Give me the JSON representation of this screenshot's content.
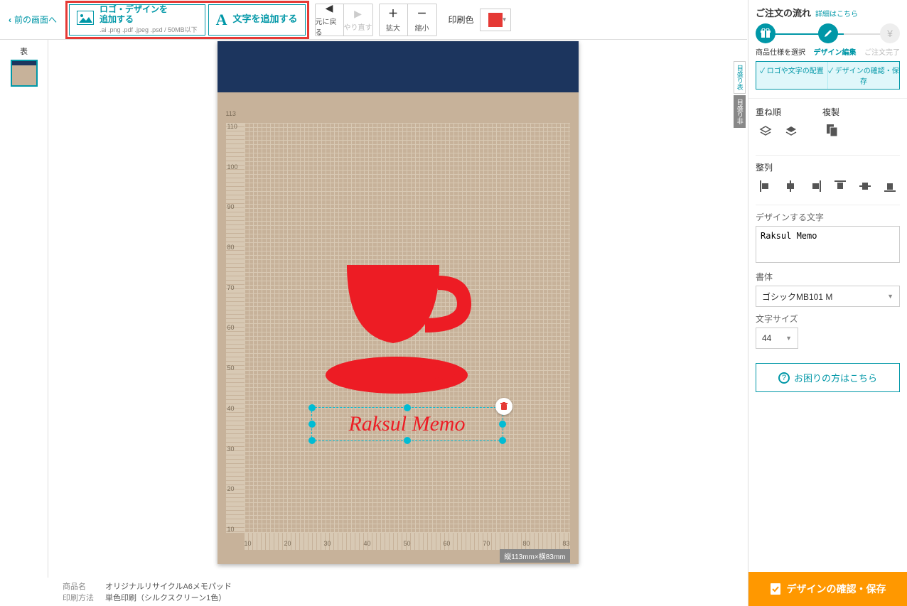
{
  "toolbar": {
    "back": "前の画面へ",
    "addLogo": {
      "main1": "ロゴ・デザインを",
      "main2": "追加する",
      "sub": ".ai .png .pdf .jpeg .psd / 50MB以下"
    },
    "addText": "文字を追加する",
    "undo": "元に戻る",
    "redo": "やり直す",
    "zoomIn": "拡大",
    "zoomOut": "縮小",
    "printColorLabel": "印刷色"
  },
  "leftRail": {
    "front": "表"
  },
  "sideTabs": {
    "show": "目盛り表",
    "hide": "目盛り非"
  },
  "canvas": {
    "textValue": "Raksul Memo",
    "sizeBadge": "縦113mm×横83mm",
    "vTicks": [
      "110",
      "100",
      "90",
      "80",
      "70",
      "60",
      "50",
      "40",
      "30",
      "20",
      "10"
    ],
    "vTop": "113",
    "hTicks": [
      "10",
      "20",
      "30",
      "40",
      "50",
      "60",
      "70",
      "80",
      "83"
    ]
  },
  "right": {
    "flowTitle": "ご注文の流れ",
    "flowMore": "詳細はこちら",
    "step1": "商品仕様を選択",
    "step2": "デザイン編集",
    "step3": "ご注文完了",
    "subTab1": "ロゴや文字の配置",
    "subTab2": "デザインの確認・保存",
    "layerLabel": "重ね順",
    "dupLabel": "複製",
    "alignLabel": "整列",
    "textFieldLabel": "デザインする文字",
    "textFieldValue": "Raksul Memo",
    "fontLabel": "書体",
    "fontValue": "ゴシックMB101 M",
    "sizeLabel": "文字サイズ",
    "sizeValue": "44",
    "help": "お困りの方はこちら",
    "confirm": "デザインの確認・保存"
  },
  "bottom": {
    "nameK": "商品名",
    "nameV": "オリジナルリサイクルA6メモパッド",
    "methodK": "印刷方法",
    "methodV": "単色印刷（シルクスクリーン1色）"
  }
}
